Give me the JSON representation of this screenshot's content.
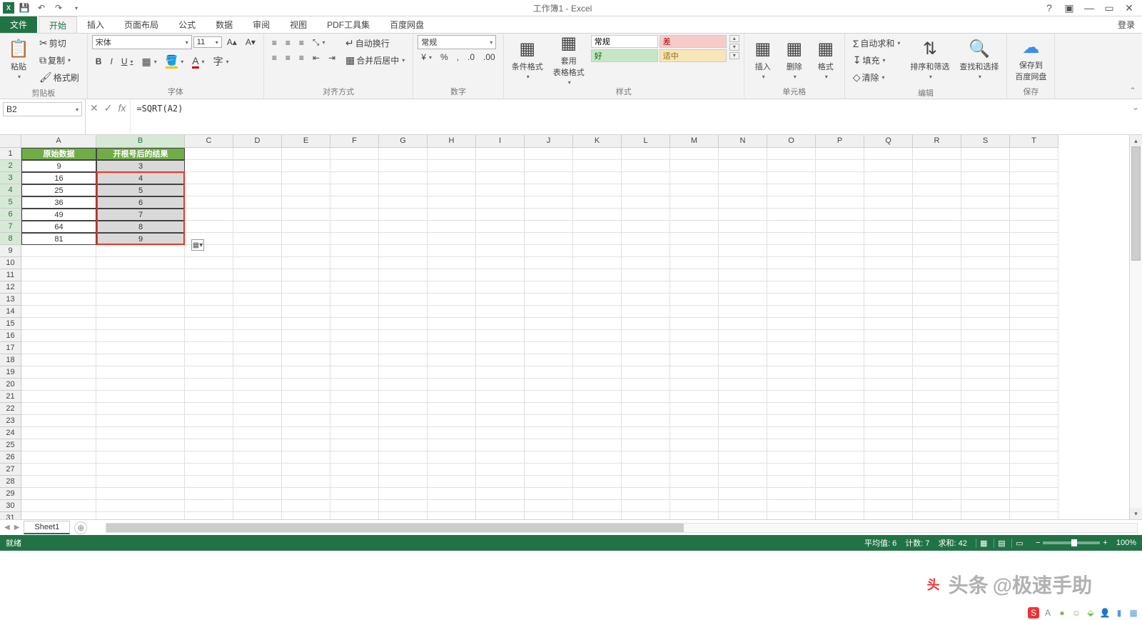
{
  "app": {
    "title": "工作簿1 - Excel",
    "login": "登录"
  },
  "qat": {
    "save": "💾",
    "undo": "↶",
    "redo": "↷"
  },
  "wincontrols": {
    "help": "?",
    "ribbon_opts": "▣",
    "min": "—",
    "restore": "▭",
    "close": "✕"
  },
  "tabs": {
    "file": "文件",
    "home": "开始",
    "insert": "插入",
    "layout": "页面布局",
    "formulas": "公式",
    "data": "数据",
    "review": "审阅",
    "view": "视图",
    "pdf": "PDF工具集",
    "baidu": "百度网盘"
  },
  "ribbon": {
    "clipboard": {
      "label": "剪贴板",
      "paste": "粘贴",
      "cut": "剪切",
      "copy": "复制",
      "format_painter": "格式刷"
    },
    "font": {
      "label": "字体",
      "name": "宋体",
      "size": "11",
      "bold": "B",
      "italic": "I",
      "underline": "U"
    },
    "align": {
      "label": "对齐方式",
      "wrap": "自动换行",
      "merge": "合并后居中"
    },
    "number": {
      "label": "数字",
      "format": "常规",
      "percent": "%",
      "comma": ",",
      "dec_inc": ".0→.00",
      "dec_dec": ".00→.0"
    },
    "styles": {
      "label": "样式",
      "cond": "条件格式",
      "table": "套用\n表格格式",
      "changgui": "常规",
      "cha": "差",
      "hao": "好",
      "shizhong": "适中"
    },
    "cells": {
      "label": "单元格",
      "insert": "插入",
      "delete": "删除",
      "format": "格式"
    },
    "editing": {
      "label": "编辑",
      "autosum": "自动求和",
      "fill": "填充",
      "clear": "清除",
      "sort": "排序和筛选",
      "find": "查找和选择"
    },
    "save": {
      "label": "保存",
      "baidu": "保存到\n百度网盘"
    }
  },
  "formula_bar": {
    "name_box": "B2",
    "fx": "fx",
    "formula": "=SQRT(A2)"
  },
  "columns": [
    "A",
    "B",
    "C",
    "D",
    "E",
    "F",
    "G",
    "H",
    "I",
    "J",
    "K",
    "L",
    "M",
    "N",
    "O",
    "P",
    "Q",
    "R",
    "S",
    "T"
  ],
  "rows": 31,
  "data": {
    "headerA": "原始数据",
    "headerB": "开根号后的结果",
    "A": [
      "9",
      "16",
      "25",
      "36",
      "49",
      "64",
      "81"
    ],
    "B": [
      "3",
      "4",
      "5",
      "6",
      "7",
      "8",
      "9"
    ]
  },
  "sheet_tabs": {
    "sheet1": "Sheet1",
    "add": "⊕"
  },
  "status": {
    "ready": "就绪",
    "avg": "平均值: 6",
    "count": "计数: 7",
    "sum": "求和: 42",
    "zoom": "100%"
  },
  "watermark": {
    "prefix": "头条",
    "handle": "@极速手助"
  }
}
